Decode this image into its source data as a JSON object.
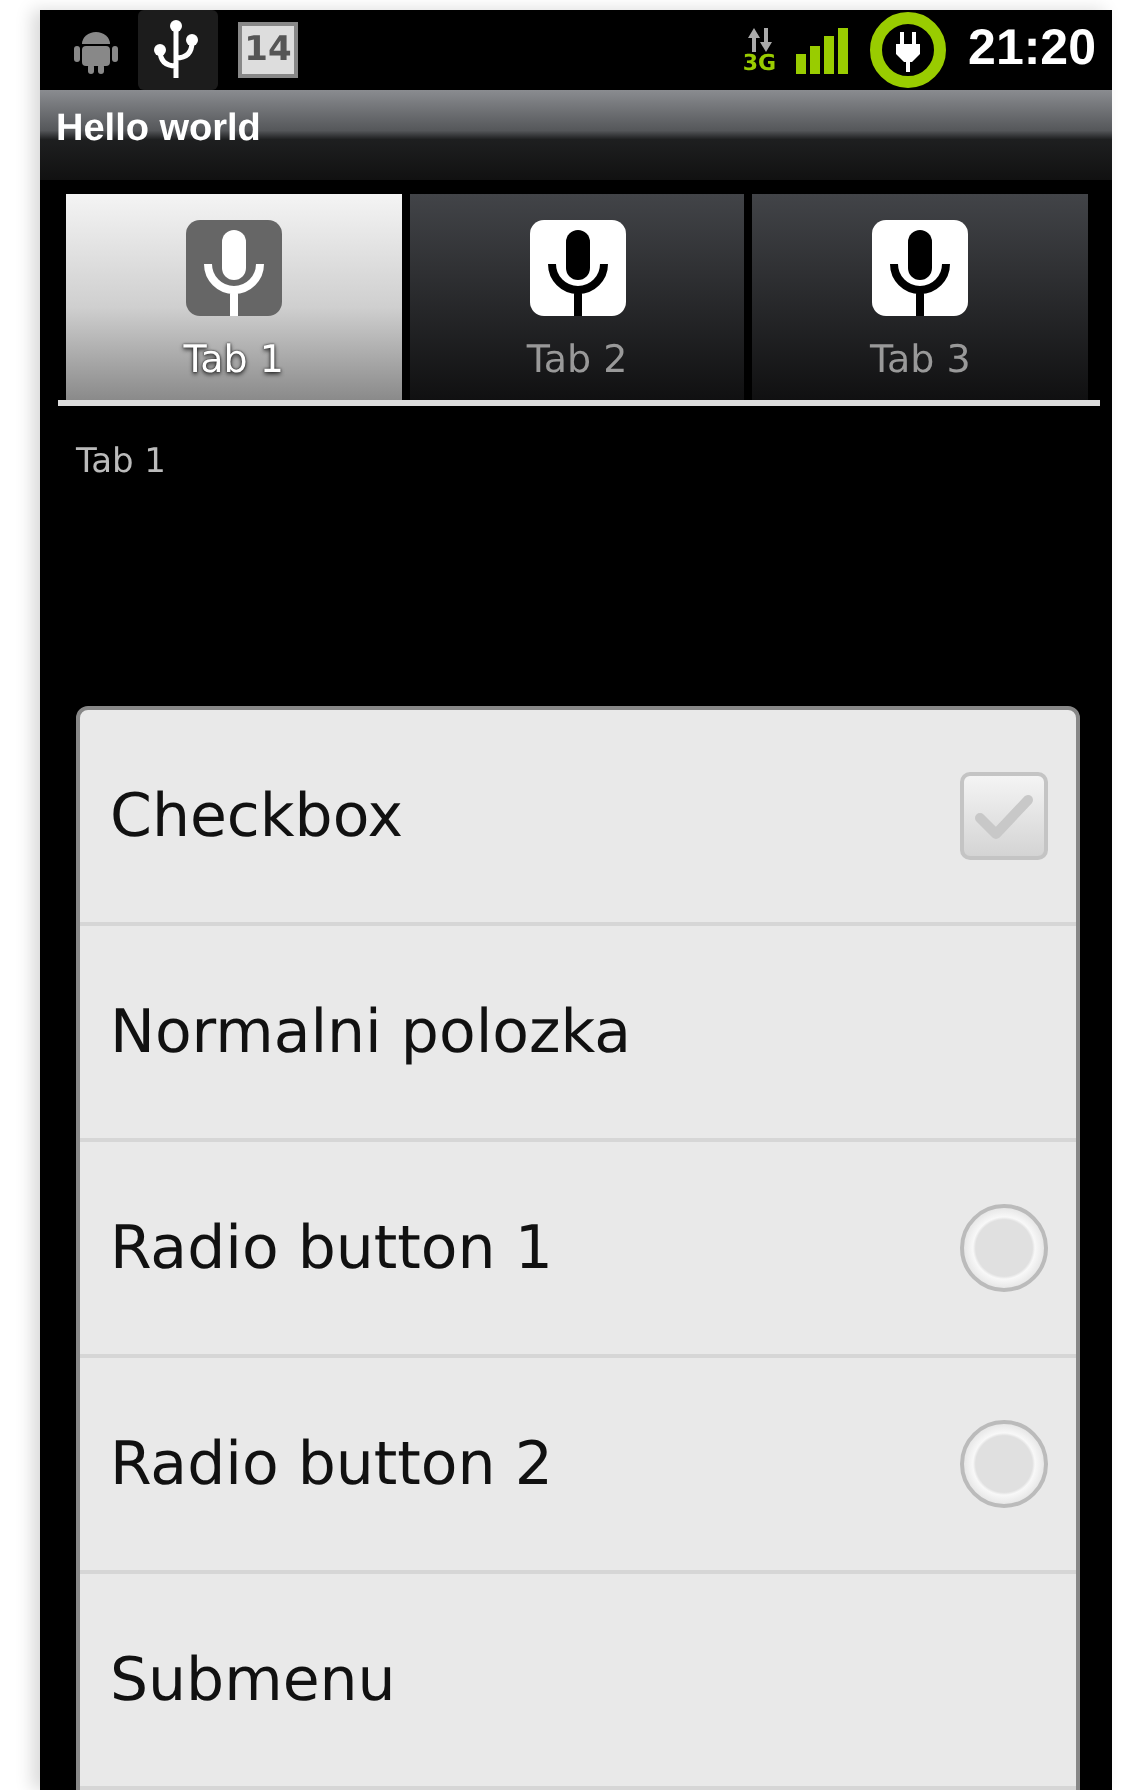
{
  "status_bar": {
    "calendar_day": "14",
    "network": "3G",
    "time": "21:20"
  },
  "title_bar": {
    "title": "Hello world"
  },
  "tabs": [
    {
      "label": "Tab 1",
      "selected": true
    },
    {
      "label": "Tab 2",
      "selected": false
    },
    {
      "label": "Tab 3",
      "selected": false
    }
  ],
  "tab_content": "Tab 1",
  "menu": [
    {
      "label": "Checkbox",
      "kind": "checkbox",
      "checked": false
    },
    {
      "label": "Normalni polozka",
      "kind": "plain"
    },
    {
      "label": "Radio button 1",
      "kind": "radio",
      "selected": false
    },
    {
      "label": "Radio button 2",
      "kind": "radio",
      "selected": false
    },
    {
      "label": "Submenu",
      "kind": "plain"
    }
  ]
}
